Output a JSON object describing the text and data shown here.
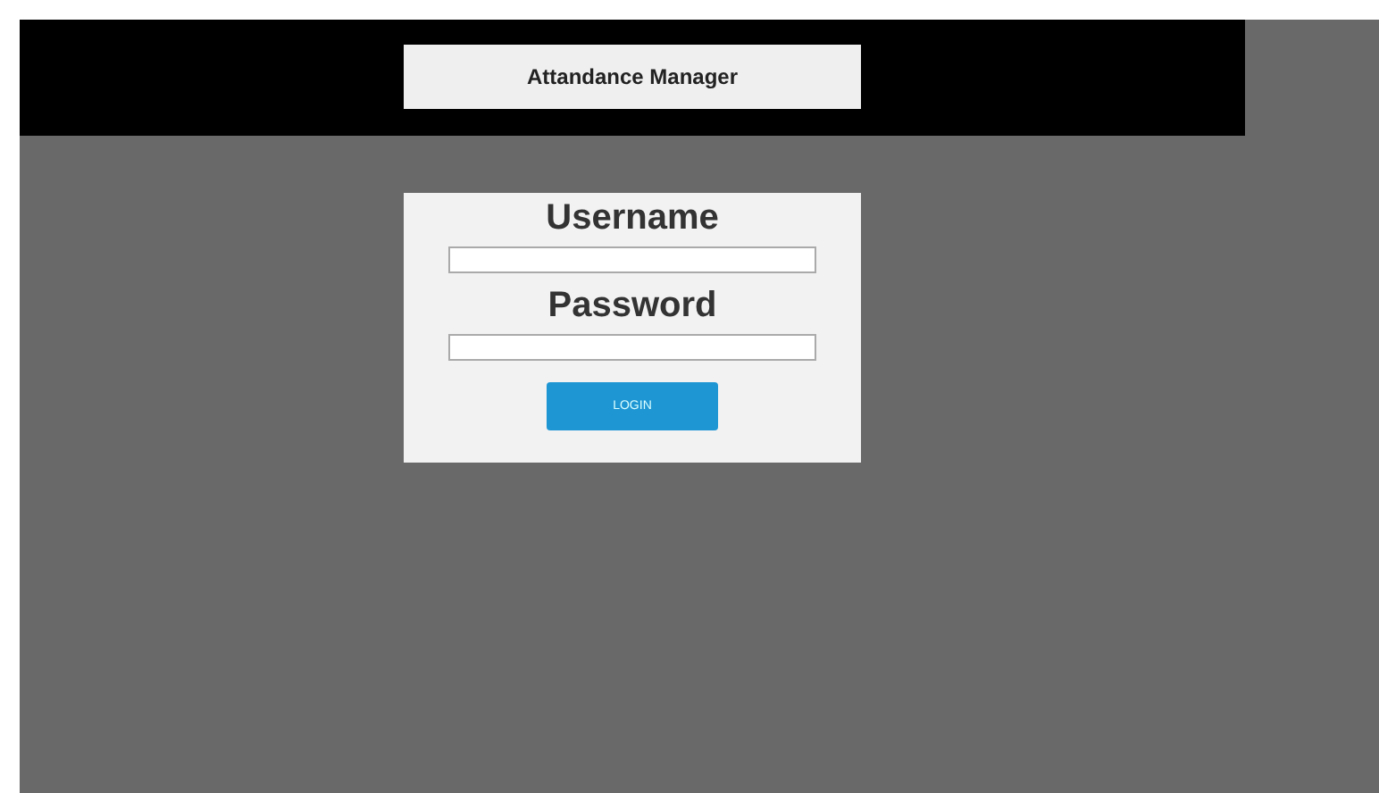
{
  "header": {
    "title": "Attandance Manager"
  },
  "login": {
    "fields": [
      {
        "label": "Username"
      },
      {
        "label": "Password"
      }
    ],
    "button": "LOGIN"
  }
}
